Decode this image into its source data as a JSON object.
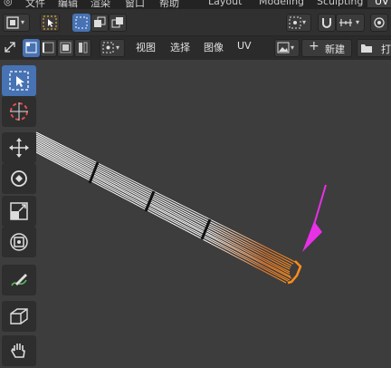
{
  "top_menu": {
    "app_icon": "blender-icon",
    "file": "文件",
    "edit": "编辑",
    "render": "渲染",
    "window": "窗口",
    "help": "帮助"
  },
  "workspaces": [
    {
      "label": "Layout",
      "active": false
    },
    {
      "label": "Modeling",
      "active": false
    },
    {
      "label": "Sculpting",
      "active": false
    },
    {
      "label": "UV",
      "active": true
    }
  ],
  "header2": {
    "view": "视图",
    "select": "选择",
    "image": "图像",
    "uv": "UV",
    "new_button": "新建",
    "open_button": "打"
  },
  "icons": {
    "editor_type": "uv-editor-icon",
    "select_box": "select-box-icon",
    "mode_new": "select-new-icon",
    "mode_extend": "select-extend-icon",
    "mode_subtract": "select-subtract-icon",
    "pivot": "pivot-icon",
    "snap": "snap-magnet-icon",
    "snap_target": "snap-increment-icon",
    "proportional": "proportional-edit-icon",
    "sync_selection": "sync-selection-icon",
    "vertex_mode": "uv-vertex-select-icon",
    "edge_mode": "uv-edge-select-icon",
    "face_mode": "uv-face-select-icon",
    "island_mode": "uv-island-select-icon",
    "sticky": "sticky-selection-icon",
    "image_browse": "image-browse-icon",
    "plus": "plus-icon",
    "folder": "folder-icon"
  },
  "toolbar": [
    {
      "name": "select-box-tool",
      "icon": "cursor-box-icon",
      "active": true
    },
    {
      "name": "cursor-tool",
      "icon": "3d-cursor-icon",
      "active": false
    },
    {
      "name": "move-tool",
      "icon": "move-icon",
      "active": false
    },
    {
      "name": "rotate-tool",
      "icon": "rotate-icon",
      "active": false
    },
    {
      "name": "scale-tool",
      "icon": "scale-icon",
      "active": false
    },
    {
      "name": "transform-tool",
      "icon": "transform-icon",
      "active": false
    },
    {
      "name": "annotate-tool",
      "icon": "annotate-pencil-icon",
      "active": false
    },
    {
      "name": "grab-tool",
      "icon": "grab-cube-icon",
      "active": false
    },
    {
      "name": "pan-tool",
      "icon": "hand-icon",
      "active": false
    }
  ],
  "colors": {
    "accent": "#4772b3",
    "viewport_bg": "#3d3d3d",
    "uv_lines": "#ffffff",
    "uv_selected": "#ff8c1a",
    "annotation_arrow": "#e830e8"
  }
}
